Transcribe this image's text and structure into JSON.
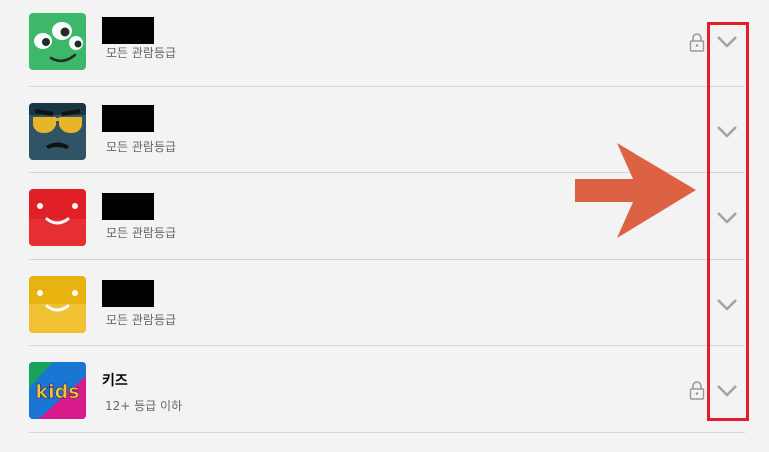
{
  "profiles": [
    {
      "avatar": "green-alien-avatar",
      "name": "",
      "redacted": true,
      "rating": "모든 관람등급",
      "locked": true
    },
    {
      "avatar": "sunglasses-mustache-avatar",
      "name": "",
      "redacted": true,
      "rating": "모든 관람등급",
      "locked": false
    },
    {
      "avatar": "red-smiley-avatar",
      "name": "",
      "redacted": true,
      "rating": "모든 관람등급",
      "locked": false
    },
    {
      "avatar": "yellow-smiley-avatar",
      "name": "",
      "redacted": true,
      "rating": "모든 관람등급",
      "locked": false
    },
    {
      "avatar": "kids-avatar",
      "name": "키즈",
      "redacted": false,
      "rating": "12+ 등급 이하",
      "locked": true,
      "avatar_text": "kids"
    }
  ],
  "colors": {
    "annotation_box": "#e21e2b",
    "annotation_arrow": "#dd6244",
    "background": "#f3f3f3",
    "divider": "#d6d6d6"
  },
  "icons": {
    "lock": "lock-icon",
    "expand": "chevron-down-icon"
  }
}
